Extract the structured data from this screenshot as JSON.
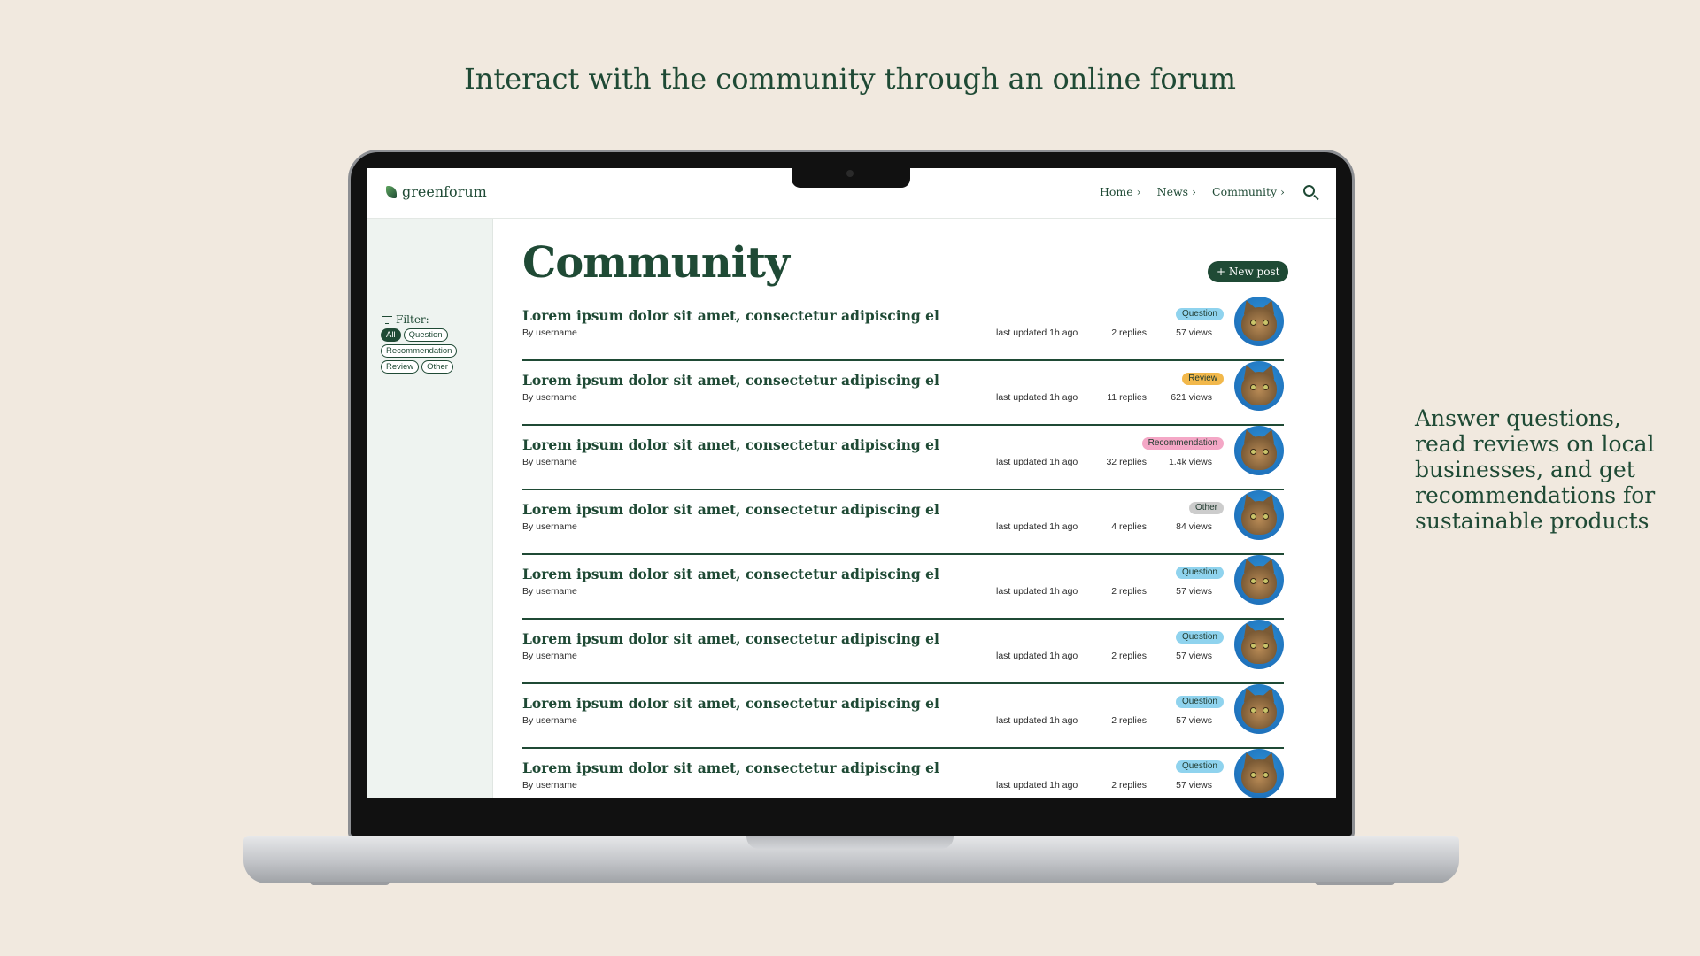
{
  "headline": "Interact with the community through an online forum",
  "side_caption": "Answer questions, read reviews on local businesses, and get recommendations for sustainable products",
  "app": {
    "logo_text": "greenforum",
    "nav": [
      {
        "label": "Home ›"
      },
      {
        "label": "News ›"
      },
      {
        "label": "Community ›"
      }
    ]
  },
  "sidebar": {
    "filter_label": "Filter:",
    "chips": [
      "All",
      "Question",
      "Recommendation",
      "Review",
      "Other"
    ]
  },
  "main": {
    "title": "Community",
    "new_post_label": "+ New post"
  },
  "tag_colors": {
    "Question": "#8fd3ee",
    "Review": "#f2b84b",
    "Recommendation": "#f4a7c6",
    "Other": "#cccccc"
  },
  "posts": [
    {
      "title": "Lorem ipsum dolor sit amet, consectetur adipiscing elit ...",
      "author": "By username",
      "updated": "last updated 1h ago",
      "replies": "2 replies",
      "views": "57 views",
      "tag": "Question"
    },
    {
      "title": "Lorem ipsum dolor sit amet, consectetur adipiscing elit ...",
      "author": "By username",
      "updated": "last updated 1h ago",
      "replies": "11 replies",
      "views": "621 views",
      "tag": "Review"
    },
    {
      "title": "Lorem ipsum dolor sit amet, consectetur adipiscing elit ...",
      "author": "By username",
      "updated": "last updated 1h ago",
      "replies": "32 replies",
      "views": "1.4k views",
      "tag": "Recommendation"
    },
    {
      "title": "Lorem ipsum dolor sit amet, consectetur adipiscing elit ...",
      "author": "By username",
      "updated": "last updated 1h ago",
      "replies": "4 replies",
      "views": "84 views",
      "tag": "Other"
    },
    {
      "title": "Lorem ipsum dolor sit amet, consectetur adipiscing elit ...",
      "author": "By username",
      "updated": "last updated 1h ago",
      "replies": "2 replies",
      "views": "57 views",
      "tag": "Question"
    },
    {
      "title": "Lorem ipsum dolor sit amet, consectetur adipiscing elit ...",
      "author": "By username",
      "updated": "last updated 1h ago",
      "replies": "2 replies",
      "views": "57 views",
      "tag": "Question"
    },
    {
      "title": "Lorem ipsum dolor sit amet, consectetur adipiscing elit ...",
      "author": "By username",
      "updated": "last updated 1h ago",
      "replies": "2 replies",
      "views": "57 views",
      "tag": "Question"
    },
    {
      "title": "Lorem ipsum dolor sit amet, consectetur adipiscing elit ...",
      "author": "By username",
      "updated": "last updated 1h ago",
      "replies": "2 replies",
      "views": "57 views",
      "tag": "Question"
    }
  ]
}
